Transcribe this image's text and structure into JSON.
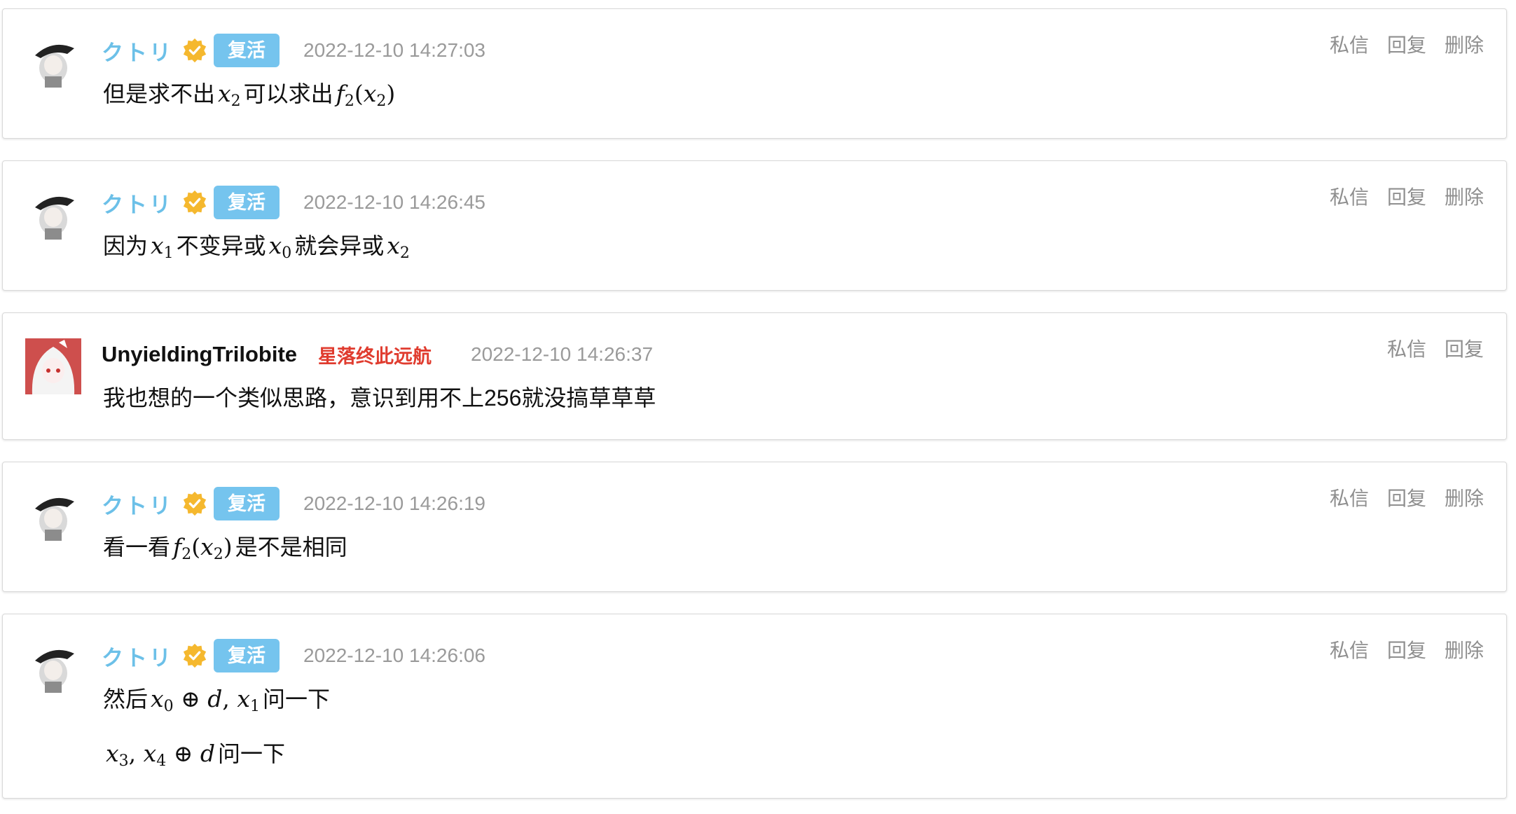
{
  "comments": [
    {
      "username": "クトリ",
      "badge": "复活",
      "time": "2022-12-10 14:27:03",
      "lines": [
        [
          "但是求不出",
          {
            "m": "x",
            "sub": "2"
          },
          "可以求出",
          {
            "m": "f",
            "sub": "2",
            "after": "(x",
            "sub2": "2",
            "close": ")"
          }
        ]
      ],
      "actions": [
        "私信",
        "回复",
        "删除"
      ]
    },
    {
      "username": "クトリ",
      "badge": "复活",
      "time": "2022-12-10 14:26:45",
      "text_parts": [
        "因为",
        "x",
        "1",
        "不变异或",
        "x",
        "0",
        "就会异或",
        "x",
        "2"
      ],
      "actions": [
        "私信",
        "回复",
        "删除"
      ]
    },
    {
      "username": "UnyieldingTrilobite",
      "badge": "星落终此远航",
      "time": "2022-12-10 14:26:37",
      "text": "我也想的一个类似思路，意识到用不上256就没搞草草草",
      "actions": [
        "私信",
        "回复"
      ]
    },
    {
      "username": "クトリ",
      "badge": "复活",
      "time": "2022-12-10 14:26:19",
      "text_parts": [
        "看一看",
        "f",
        "2",
        "(",
        "x",
        "2",
        ")",
        "是不是相同"
      ],
      "actions": [
        "私信",
        "回复",
        "删除"
      ]
    },
    {
      "username": "クトリ",
      "badge": "复活",
      "time": "2022-12-10 14:26:06",
      "line1_parts": [
        "然后",
        "x",
        "0",
        "⊕",
        "d",
        ",",
        "x",
        "1",
        "问一下"
      ],
      "line2_parts": [
        "x",
        "3",
        ",",
        "x",
        "4",
        "⊕",
        "d",
        "问一下"
      ],
      "actions": [
        "私信",
        "回复",
        "删除"
      ]
    }
  ],
  "icons": {
    "verified": "verified-check-icon",
    "avatar": "avatar-image"
  },
  "colors": {
    "username_blue": "#6cc0e8",
    "badge_blue": "#75c4ee",
    "badge_red": "#e03c2f",
    "verified_gold": "#f5b82e",
    "muted": "#9a9a9a"
  }
}
